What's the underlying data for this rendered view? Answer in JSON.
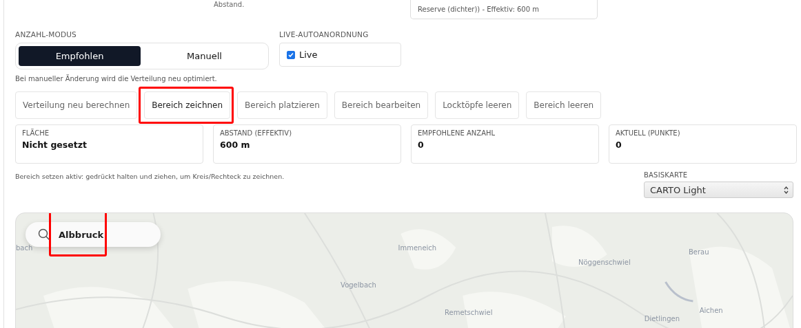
{
  "top_fragment": {
    "note": "Abstand.",
    "field_value": "Reserve (dichter)) - Effektiv: 600 m"
  },
  "count_mode": {
    "label": "ANZAHL-MODUS",
    "options": [
      {
        "label": "Empfohlen",
        "selected": true
      },
      {
        "label": "Manuell",
        "selected": false
      }
    ],
    "hint": "Bei manueller Änderung wird die Verteilung neu optimiert."
  },
  "live": {
    "label": "LIVE-AUTOANORDNUNG",
    "checkbox": {
      "label": "Live",
      "checked": true
    }
  },
  "actions": [
    {
      "label": "Verteilung neu berechnen",
      "highlighted": false
    },
    {
      "label": "Bereich zeichnen",
      "highlighted": true
    },
    {
      "label": "Bereich platzieren",
      "highlighted": false
    },
    {
      "label": "Bereich bearbeiten",
      "highlighted": false
    },
    {
      "label": "Locktöpfe leeren",
      "highlighted": false
    },
    {
      "label": "Bereich leeren",
      "highlighted": false
    }
  ],
  "stats": [
    {
      "label": "FLÄCHE",
      "value": "Nicht gesetzt"
    },
    {
      "label": "ABSTAND (EFFEKTIV)",
      "value": "600 m"
    },
    {
      "label": "EMPFOHLENE ANZAHL",
      "value": "0"
    },
    {
      "label": "AKTUELL (PUNKTE)",
      "value": "0"
    }
  ],
  "draw_hint": "Bereich setzen aktiv: gedrückt halten und ziehen, um Kreis/Rechteck zu zeichnen.",
  "basemap": {
    "label": "BASISKARTE",
    "value": "CARTO Light"
  },
  "map": {
    "search": {
      "value": "Albbruck",
      "highlighted": true
    },
    "places": [
      {
        "name": "bach"
      },
      {
        "name": "Immeneich"
      },
      {
        "name": "Vogelbach"
      },
      {
        "name": "Nöggenschwiel"
      },
      {
        "name": "Berau"
      },
      {
        "name": "Remetschwiel"
      },
      {
        "name": "Dietlingen"
      },
      {
        "name": "Aichen"
      }
    ]
  }
}
